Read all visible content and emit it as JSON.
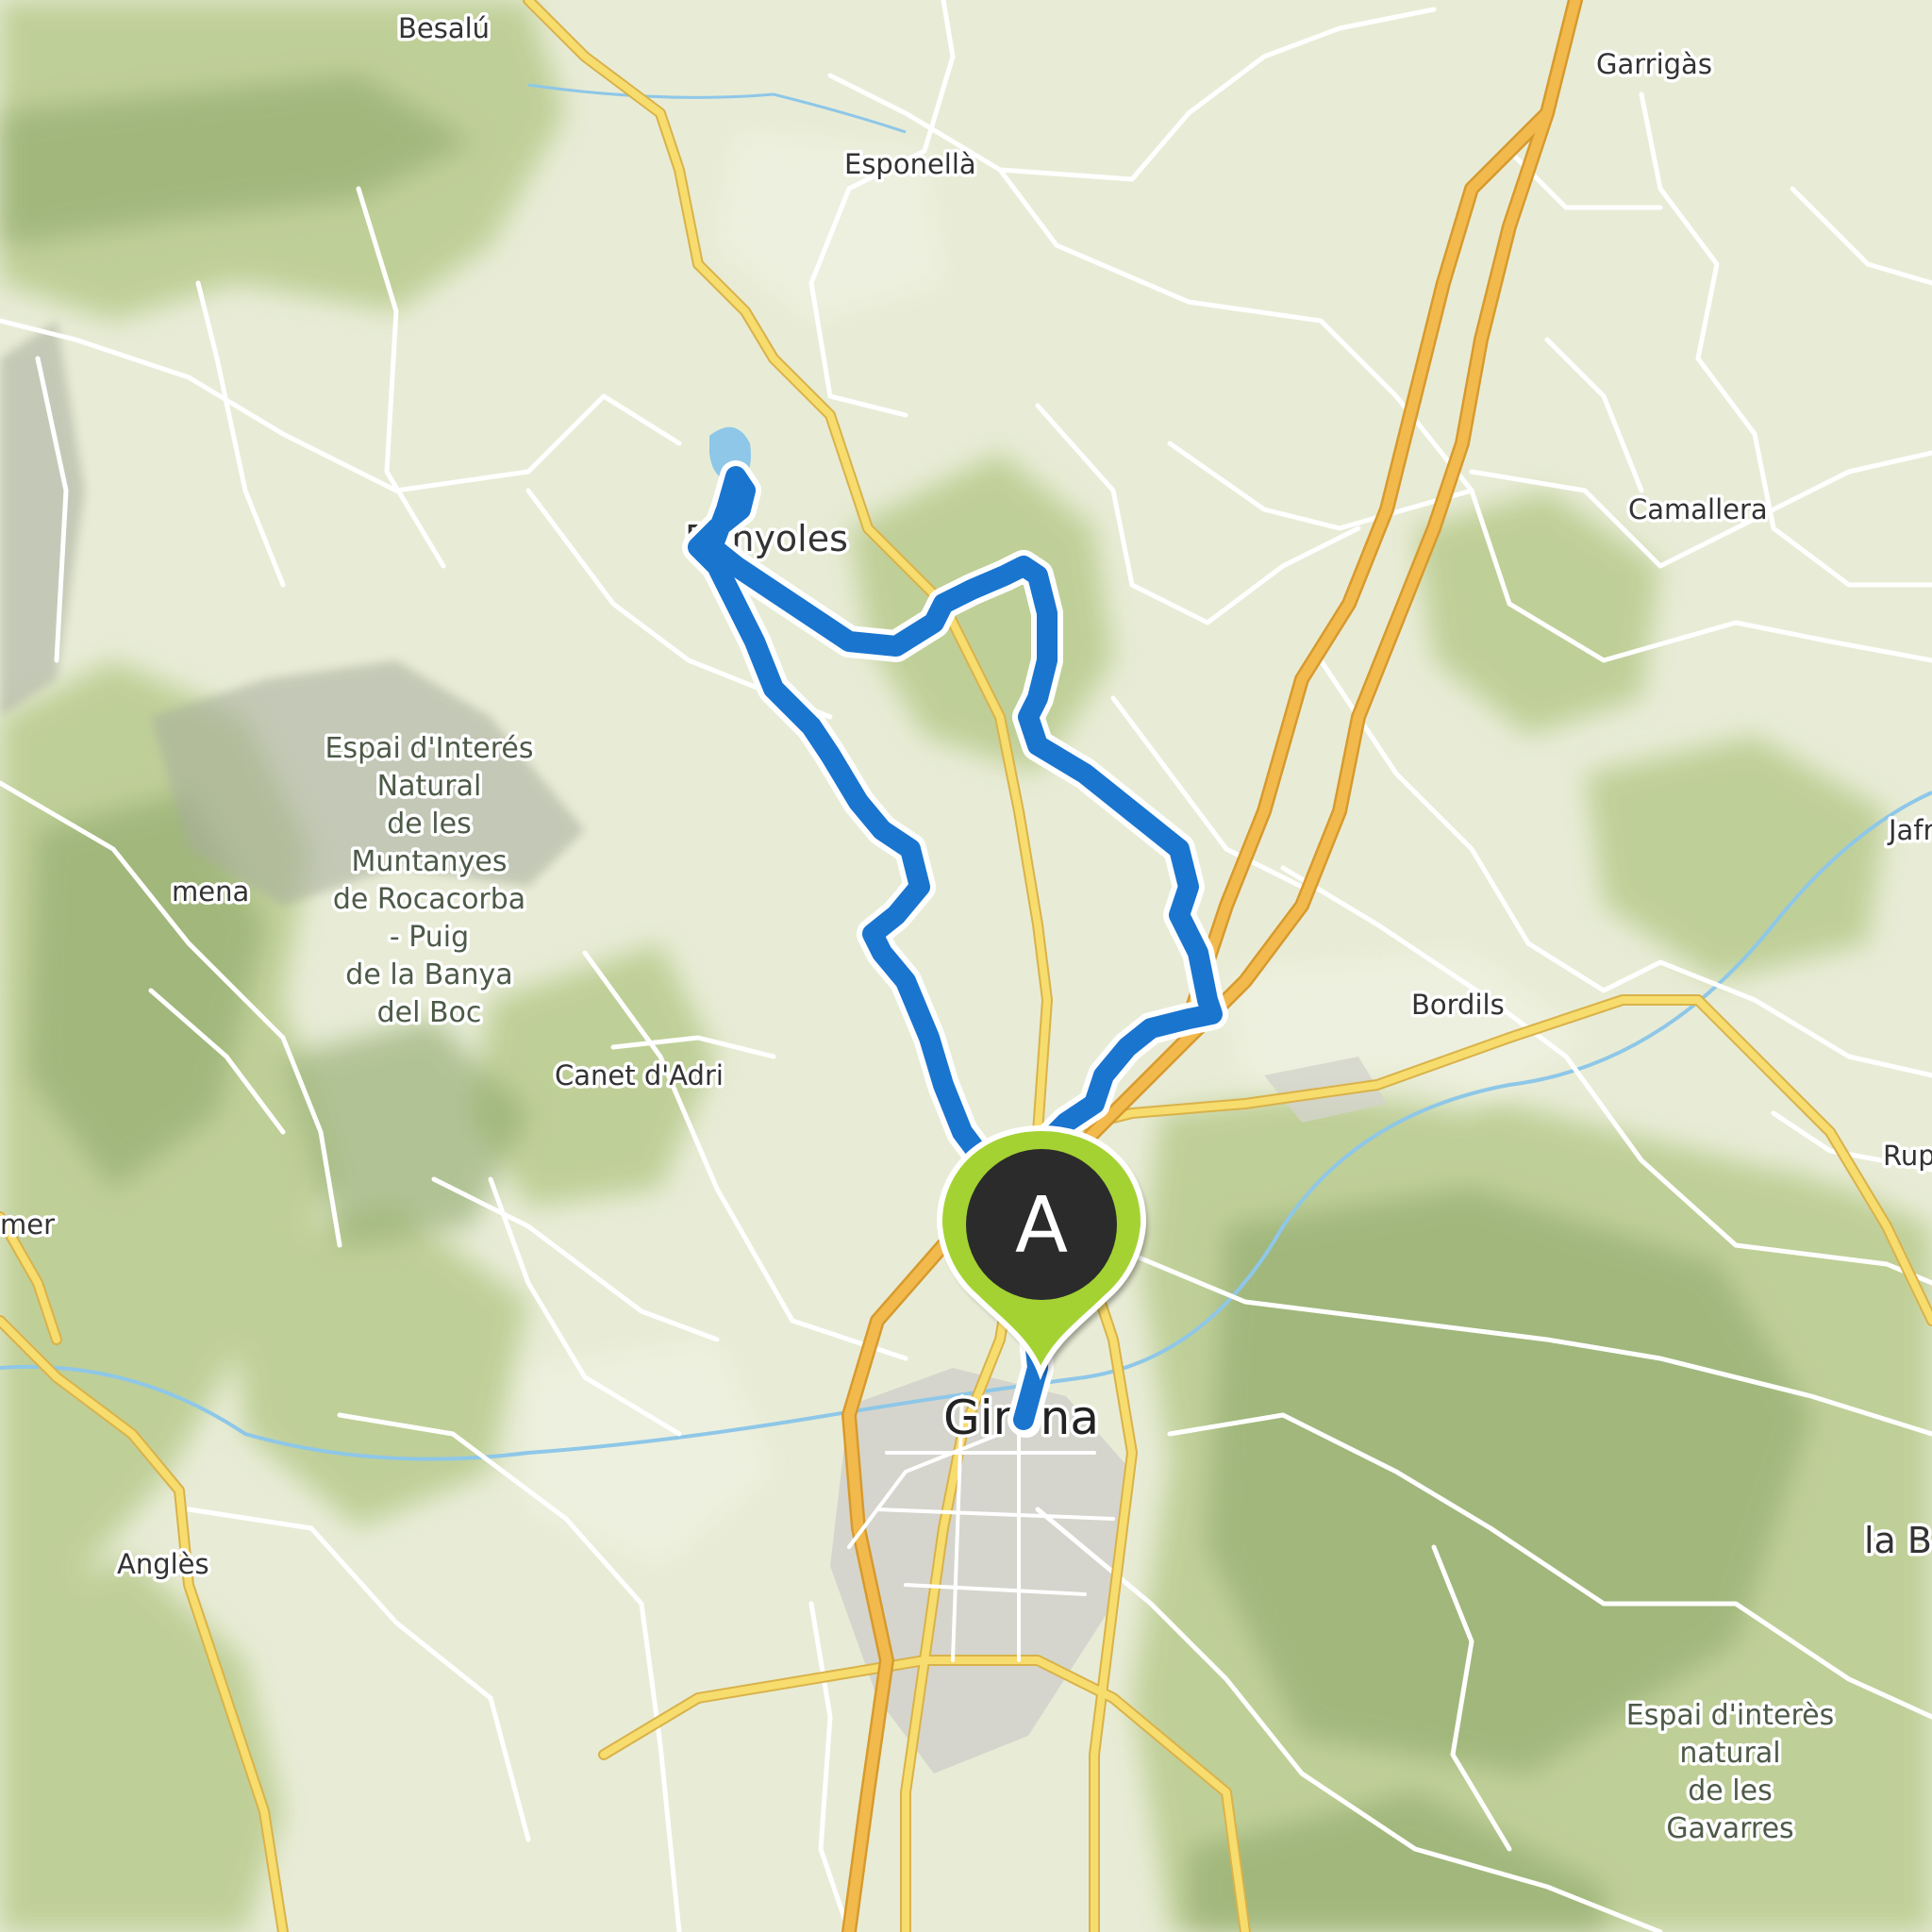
{
  "map": {
    "places": [
      {
        "id": "besalu",
        "label": "Besalú"
      },
      {
        "id": "garrigas",
        "label": "Garrigàs"
      },
      {
        "id": "esponella",
        "label": "Esponellà"
      },
      {
        "id": "banyoles",
        "label": "Banyoles"
      },
      {
        "id": "camallera",
        "label": "Camallera"
      },
      {
        "id": "jafre",
        "label": "Jafr"
      },
      {
        "id": "amena",
        "label": "mena"
      },
      {
        "id": "bordils",
        "label": "Bordils"
      },
      {
        "id": "canet",
        "label": "Canet d'Adri"
      },
      {
        "id": "rupia",
        "label": "Rup"
      },
      {
        "id": "amer",
        "label": "mer"
      },
      {
        "id": "girona",
        "label": "Girona"
      },
      {
        "id": "angles",
        "label": "Anglès"
      },
      {
        "id": "labisbal",
        "label": "la B"
      }
    ],
    "areas": [
      {
        "id": "rocacorba",
        "lines": [
          "Espai d'Interés",
          "Natural",
          "de les",
          "Muntanyes",
          "de Rocacorba",
          "- Puig",
          "de la Banya",
          "del Boc"
        ]
      },
      {
        "id": "gavarres",
        "lines": [
          "Espai d'interès",
          "natural",
          "de les",
          "Gavarres"
        ]
      }
    ],
    "marker": {
      "label": "A",
      "color": "#a4d233",
      "inner_color": "#2b2b2b"
    },
    "route": {
      "color": "#1a75cf",
      "outline": "#ffffff"
    },
    "colors": {
      "base": "#e8ecd6",
      "forest": "#c6d59c",
      "forest_dark": "#9fb77d",
      "water": "#8ec7e8",
      "motorway": "#f2b94d",
      "main_road": "#f7dc6e",
      "minor_road": "#ffffff",
      "urban": "#d6d6d0"
    }
  }
}
